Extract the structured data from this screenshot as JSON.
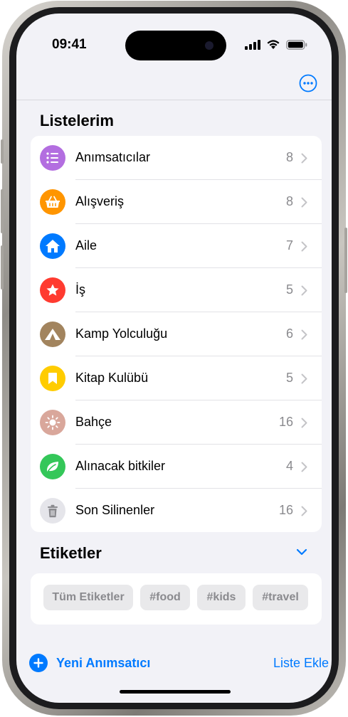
{
  "status_bar": {
    "time": "09:41"
  },
  "header": {
    "more_icon": "ellipsis-circle-icon"
  },
  "lists_section": {
    "title": "Listelerim",
    "items": [
      {
        "label": "Anımsatıcılar",
        "count": "8",
        "icon": "list-bullet-icon",
        "color": "#b36ee0"
      },
      {
        "label": "Alışveriş",
        "count": "8",
        "icon": "basket-icon",
        "color": "#ff9500"
      },
      {
        "label": "Aile",
        "count": "7",
        "icon": "house-icon",
        "color": "#007aff"
      },
      {
        "label": "İş",
        "count": "5",
        "icon": "star-icon",
        "color": "#ff3b30"
      },
      {
        "label": "Kamp Yolculuğu",
        "count": "6",
        "icon": "tent-icon",
        "color": "#a2845e"
      },
      {
        "label": "Kitap Kulübü",
        "count": "5",
        "icon": "bookmark-icon",
        "color": "#ffcc00"
      },
      {
        "label": "Bahçe",
        "count": "16",
        "icon": "sun-icon",
        "color": "#d9a79b"
      },
      {
        "label": "Alınacak bitkiler",
        "count": "4",
        "icon": "leaf-icon",
        "color": "#34c759"
      },
      {
        "label": "Son Silinenler",
        "count": "16",
        "icon": "trash-icon",
        "color": "#e5e5ea"
      }
    ]
  },
  "tags_section": {
    "title": "Etiketler",
    "tags": [
      "Tüm Etiketler",
      "#food",
      "#kids",
      "#travel"
    ]
  },
  "bottom_bar": {
    "new_reminder": "Yeni Anımsatıcı",
    "add_list": "Liste Ekle"
  },
  "colors": {
    "accent": "#007aff",
    "background": "#f2f2f7"
  }
}
